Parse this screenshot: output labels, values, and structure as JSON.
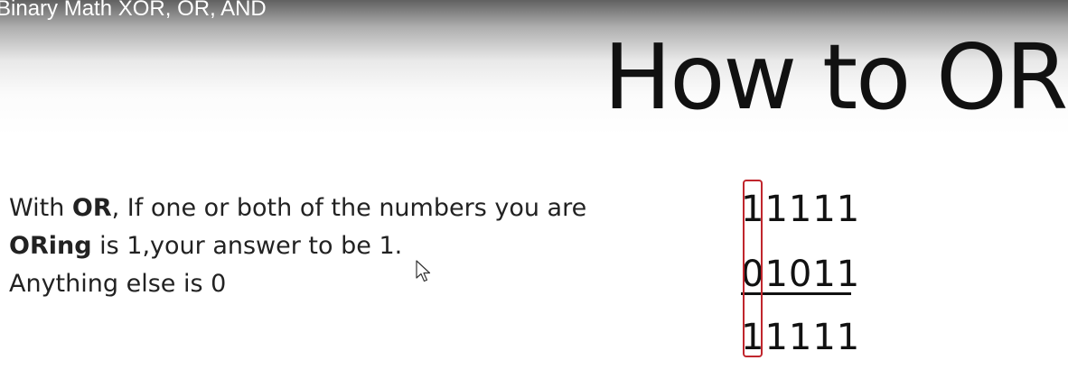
{
  "video": {
    "title": "Binary Math XOR, OR, AND"
  },
  "slide": {
    "heading": "How to OR",
    "explanation": {
      "line1_prefix": "With ",
      "line1_bold": "OR",
      "line1_suffix": ", If one or both of the numbers you are",
      "line2_bold": "ORing",
      "line2_suffix": " is 1,your answer to be 1.",
      "line3": "Anything else is 0"
    },
    "binary_rows": [
      "11111",
      "01011",
      "11111"
    ],
    "highlight_color": "#c0262d"
  },
  "icons": {
    "pointer": "mouse-pointer-icon"
  }
}
